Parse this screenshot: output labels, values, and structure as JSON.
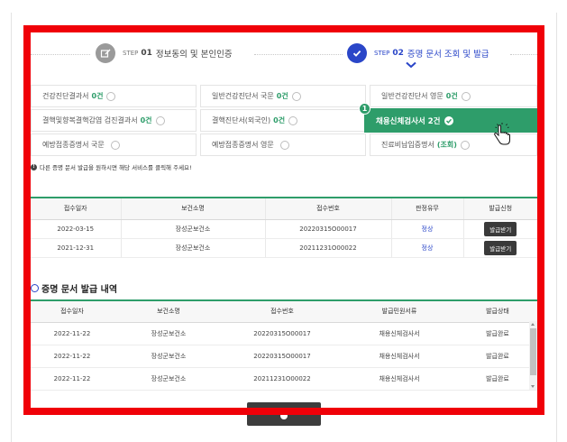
{
  "steps": [
    {
      "label": "STEP",
      "num": "01",
      "title": "정보동의 및 본인인증"
    },
    {
      "label": "STEP",
      "num": "02",
      "title": "증명 문서 조회 및 발급"
    }
  ],
  "services": [
    {
      "name": "건강진단결과서",
      "count": "0건"
    },
    {
      "name": "일반건강진단서 국문",
      "count": "0건"
    },
    {
      "name": "일반건강진단서 영문",
      "count": "0건"
    },
    {
      "name": "결핵및향복결핵감염 검진결과서",
      "count": "0건"
    },
    {
      "name": "결핵진단서(외국인)",
      "count": "0건"
    },
    {
      "name": "채용신체검사서",
      "count": "2건",
      "step_badge": "1"
    },
    {
      "name": "예방접종증명서 국문",
      "count": ""
    },
    {
      "name": "예방접종증명서 영문",
      "count": ""
    },
    {
      "name": "진료비납입증명서",
      "count": "(조회)"
    }
  ],
  "notice": "다른 증명 문서 발급을 원하시면 해당 서비스를 클릭해 주세요!",
  "results_table": {
    "headers": [
      "접수일자",
      "보건소명",
      "접수번호",
      "판정유무",
      "발급신청"
    ],
    "rows": [
      {
        "date": "2022-03-15",
        "center": "장성군보건소",
        "number": "20220315O00017",
        "result": "정상",
        "action": "발급받기"
      },
      {
        "date": "2021-12-31",
        "center": "장성군보건소",
        "number": "20211231O00022",
        "result": "정상",
        "action": "발급받기"
      }
    ]
  },
  "history": {
    "title": "증명 문서 발급 내역",
    "headers": [
      "접수일자",
      "보건소명",
      "접수번호",
      "발급민원서류",
      "발급상태"
    ],
    "rows": [
      {
        "date": "2022-11-22",
        "center": "장성군보건소",
        "number": "20220315O00017",
        "doc": "채용신체검사서",
        "status": "발급완료"
      },
      {
        "date": "2022-11-22",
        "center": "장성군보건소",
        "number": "20220315O00017",
        "doc": "채용신체검사서",
        "status": "발급완료"
      },
      {
        "date": "2022-11-22",
        "center": "장성군보건소",
        "number": "20211231O00022",
        "doc": "채용신체검사서",
        "status": "발급완료"
      }
    ]
  },
  "colors": {
    "accent_green": "#2e9d6a",
    "accent_blue": "#2a46c8",
    "highlight_border": "#f00008",
    "dark_button": "#3a3a3a"
  },
  "icons": [
    "edit-icon",
    "check-circle-icon",
    "chevron-down-icon",
    "hand-pointer-icon",
    "info-icon",
    "history-icon"
  ]
}
